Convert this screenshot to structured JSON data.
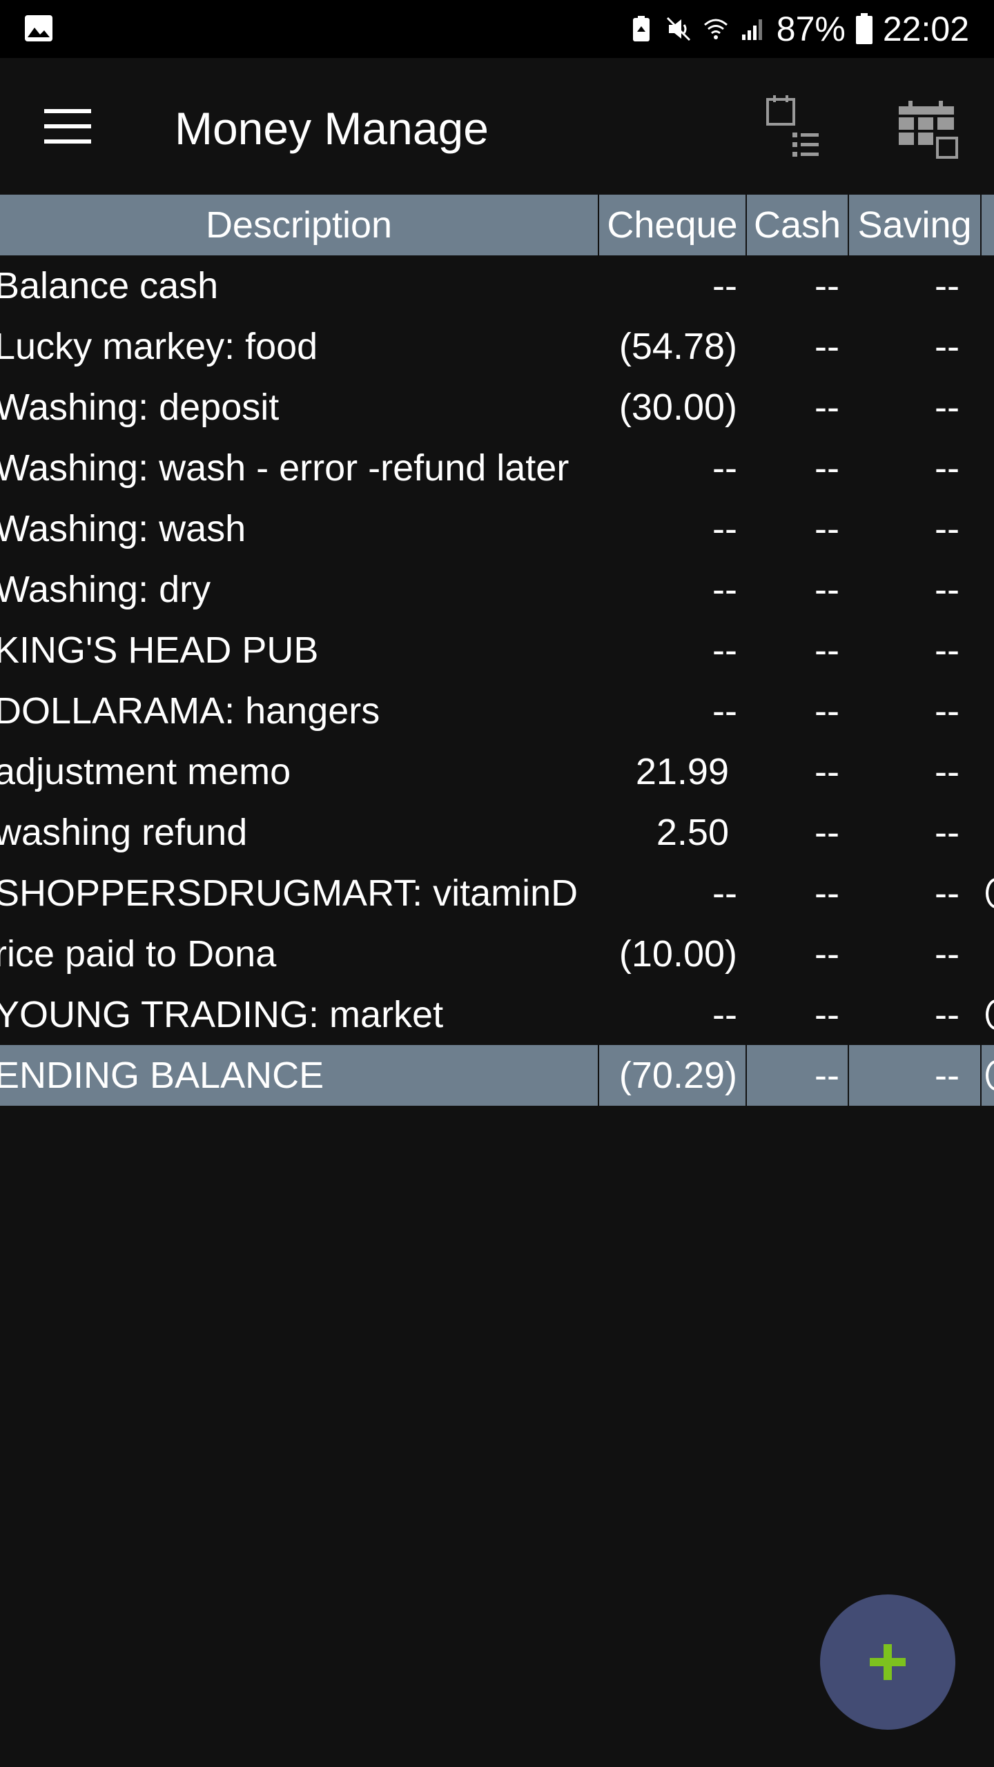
{
  "status_bar": {
    "battery_percent": "87%",
    "time": "22:02",
    "icons": [
      "gallery-icon",
      "battery-saver-icon",
      "mute-icon",
      "wifi-icon",
      "signal-icon",
      "battery-icon"
    ]
  },
  "app_bar": {
    "title": "Money Manage",
    "icons": [
      "menu-icon",
      "list-view-icon",
      "calendar-icon"
    ]
  },
  "table": {
    "columns": [
      "Description",
      "Cheque",
      "Cash",
      "Saving"
    ],
    "rows": [
      {
        "description": "Balance cash",
        "cheque": "--",
        "cash": "--",
        "saving": "--",
        "edge": false
      },
      {
        "description": "Lucky markey: food",
        "cheque": "(54.78)",
        "cash": "--",
        "saving": "--",
        "edge": false
      },
      {
        "description": "Washing: deposit",
        "cheque": "(30.00)",
        "cash": "--",
        "saving": "--",
        "edge": false
      },
      {
        "description": "Washing: wash - error -refund later",
        "cheque": "--",
        "cash": "--",
        "saving": "--",
        "edge": false
      },
      {
        "description": "Washing: wash",
        "cheque": "--",
        "cash": "--",
        "saving": "--",
        "edge": false
      },
      {
        "description": "Washing: dry",
        "cheque": "--",
        "cash": "--",
        "saving": "--",
        "edge": false
      },
      {
        "description": "KING'S HEAD PUB",
        "cheque": "--",
        "cash": "--",
        "saving": "--",
        "edge": false
      },
      {
        "description": "DOLLARAMA: hangers",
        "cheque": "--",
        "cash": "--",
        "saving": "--",
        "edge": false
      },
      {
        "description": "adjustment memo",
        "cheque": "21.99",
        "cash": "--",
        "saving": "--",
        "edge": false
      },
      {
        "description": "washing refund",
        "cheque": "2.50",
        "cash": "--",
        "saving": "--",
        "edge": false
      },
      {
        "description": "SHOPPERSDRUGMART: vitaminD",
        "cheque": "--",
        "cash": "--",
        "saving": "--",
        "edge": true
      },
      {
        "description": "rice paid to Dona",
        "cheque": "(10.00)",
        "cash": "--",
        "saving": "--",
        "edge": false
      },
      {
        "description": "YOUNG TRADING: market",
        "cheque": "--",
        "cash": "--",
        "saving": "--",
        "edge": true
      }
    ],
    "ending": {
      "description": "ENDING BALANCE",
      "cheque": "(70.29)",
      "cash": "--",
      "saving": "--"
    }
  },
  "fab": {
    "icon": "plus-icon",
    "color": "#434c74",
    "plus_color": "#7dc21e"
  },
  "colors": {
    "background": "#111111",
    "header_row": "#6e7f8e",
    "status_bar": "#000000"
  }
}
